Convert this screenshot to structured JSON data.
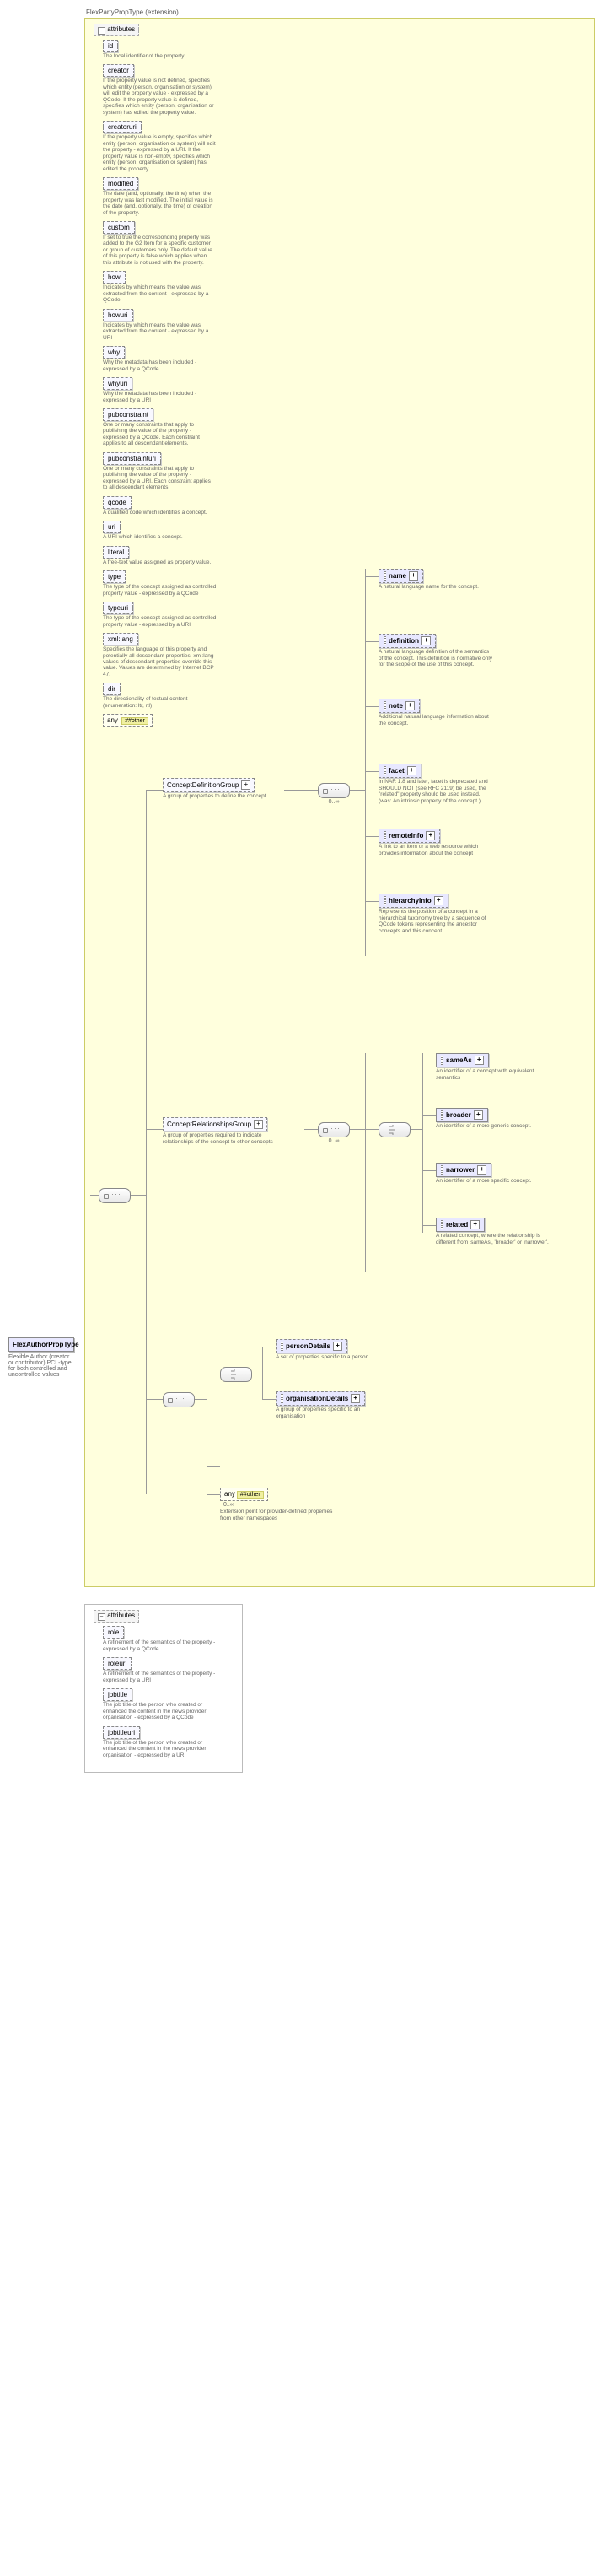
{
  "extension_title": "FlexPartyPropType (extension)",
  "root": {
    "name": "FlexAuthorPropType",
    "desc": "Flexible Author (creator or contributor) PCL-type for both controlled and uncontrolled values"
  },
  "legend": "attributes",
  "attrs1": [
    {
      "name": "id",
      "desc": "The local identifier of the property."
    },
    {
      "name": "creator",
      "desc": "If the property value is not defined, specifies which entity (person, organisation or system) will edit the property value - expressed by a QCode. If the property value is defined, specifies which entity (person, organisation or system) has edited the property value."
    },
    {
      "name": "creatoruri",
      "desc": "If the property value is empty, specifies which entity (person, organisation or system) will edit the property - expressed by a URI. If the property value is non-empty, specifies which entity (person, organisation or system) has edited the property."
    },
    {
      "name": "modified",
      "desc": "The date (and, optionally, the time) when the property was last modified. The initial value is the date (and, optionally, the time) of creation of the property."
    },
    {
      "name": "custom",
      "desc": "If set to true the corresponding property was added to the G2 Item for a specific customer or group of customers only. The default value of this property is false which applies when this attribute is not used with the property."
    },
    {
      "name": "how",
      "desc": "Indicates by which means the value was extracted from the content - expressed by a QCode"
    },
    {
      "name": "howuri",
      "desc": "Indicates by which means the value was extracted from the content - expressed by a URI"
    },
    {
      "name": "why",
      "desc": "Why the metadata has been included - expressed by a QCode"
    },
    {
      "name": "whyuri",
      "desc": "Why the metadata has been included - expressed by a URI"
    },
    {
      "name": "pubconstraint",
      "desc": "One or many constraints that apply to publishing the value of the property - expressed by a QCode. Each constraint applies to all descendant elements."
    },
    {
      "name": "pubconstrainturi",
      "desc": "One or many constraints that apply to publishing the value of the property - expressed by a URI. Each constraint applies to all descendant elements."
    },
    {
      "name": "qcode",
      "desc": "A qualified code which identifies a concept."
    },
    {
      "name": "uri",
      "desc": "A URI which identifies a concept."
    },
    {
      "name": "literal",
      "desc": "A free-text value assigned as property value."
    },
    {
      "name": "type",
      "desc": "The type of the concept assigned as controlled property value - expressed by a QCode"
    },
    {
      "name": "typeuri",
      "desc": "The type of the concept assigned as controlled property value - expressed by a URI"
    },
    {
      "name": "xml:lang",
      "desc": "Specifies the language of this property and potentially all descendant properties. xml:lang values of descendant properties override this value. Values are determined by Internet BCP 47."
    },
    {
      "name": "dir",
      "desc": "The directionality of textual content (enumeration: ltr, rtl)"
    }
  ],
  "any_other": {
    "label": "any",
    "ns": "##other"
  },
  "groups": {
    "def": {
      "name": "ConceptDefinitionGroup",
      "desc": "A group of properties to define the concept",
      "card": "0..∞"
    },
    "rel": {
      "name": "ConceptRelationshipsGroup",
      "desc": "A group of properties required to indicate relationships of the concept to other concepts",
      "card": "0..∞"
    }
  },
  "def_children": [
    {
      "name": "name",
      "desc": "A natural language name for the concept."
    },
    {
      "name": "definition",
      "desc": "A natural language definition of the semantics of the concept. This definition is normative only for the scope of the use of this concept."
    },
    {
      "name": "note",
      "desc": "Additional natural language information about the concept."
    },
    {
      "name": "facet",
      "desc": "In NAR 1.8 and later, facet is deprecated and SHOULD NOT (see RFC 2119) be used, the \"related\" property should be used instead. (was: An intrinsic property of the concept.)"
    },
    {
      "name": "remoteInfo",
      "desc": "A link to an item or a web resource which provides information about the concept"
    },
    {
      "name": "hierarchyInfo",
      "desc": "Represents the position of a concept in a hierarchical taxonomy tree by a sequence of QCode tokens representing the ancestor concepts and this concept"
    }
  ],
  "rel_children": [
    {
      "name": "sameAs",
      "desc": "An identifier of a concept with equivalent semantics"
    },
    {
      "name": "broader",
      "desc": "An identifier of a more generic concept."
    },
    {
      "name": "narrower",
      "desc": "An identifier of a more specific concept."
    },
    {
      "name": "related",
      "desc": "A related concept, where the relationship is different from 'sameAs', 'broader' or 'narrower'."
    }
  ],
  "details": {
    "person": {
      "name": "personDetails",
      "desc": "A set of properties specific to a person"
    },
    "org": {
      "name": "organisationDetails",
      "desc": "A group of properties specific to an organisation"
    }
  },
  "ext_any": {
    "label": "any",
    "ns": "##other",
    "card": "0..∞",
    "desc": "Extension point for provider-defined properties from other namespaces"
  },
  "attrs2": [
    {
      "name": "role",
      "desc": "A refinement of the semantics of the property - expressed by a QCode"
    },
    {
      "name": "roleuri",
      "desc": "A refinement of the semantics of the property - expressed by a URI"
    },
    {
      "name": "jobtitle",
      "desc": "The job title of the person who created or enhanced the content in the news provider organisation - expressed by a QCode"
    },
    {
      "name": "jobtitleuri",
      "desc": "The job title of the person who created or enhanced the content in the news provider organisation - expressed by a URI"
    }
  ]
}
